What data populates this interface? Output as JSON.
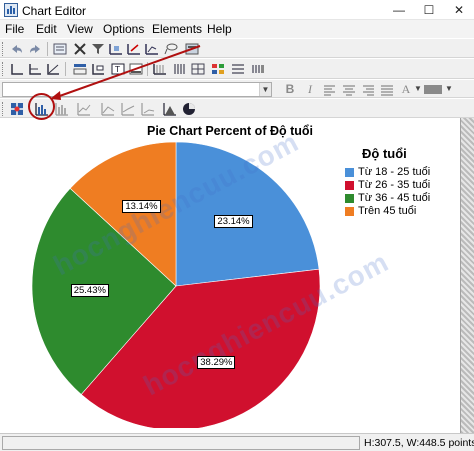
{
  "window": {
    "title": "Chart Editor",
    "minimize_glyph": "—",
    "maximize_glyph": "☐",
    "close_glyph": "✕"
  },
  "menu": [
    "File",
    "Edit",
    "View",
    "Options",
    "Elements",
    "Help"
  ],
  "format": {
    "bold_label": "B",
    "italic_label": "I",
    "text_label": "A"
  },
  "chart_data": {
    "type": "pie",
    "title": "Pie Chart Percent of Độ tuổi",
    "legend_title": "Độ tuổi",
    "legend_placement": "right",
    "categories": [
      "Từ 18 - 25 tuổi",
      "Từ 26 - 35 tuổi",
      "Từ 36 - 45 tuổi",
      "Trên 45 tuổi"
    ],
    "values": [
      23.14,
      38.29,
      25.43,
      13.14
    ],
    "labels": [
      "23.14%",
      "38.29%",
      "25.43%",
      "13.14%"
    ],
    "colors": [
      "#4a90d9",
      "#d0102e",
      "#2e8b2e",
      "#ef7d22"
    ],
    "start": "12 o'clock",
    "direction": "clockwise"
  },
  "status": {
    "text": "H:307.5, W:448.5 points"
  },
  "watermark": {
    "text": "hocnghiencuu.com"
  },
  "annotation": {
    "color": "#b01010"
  }
}
